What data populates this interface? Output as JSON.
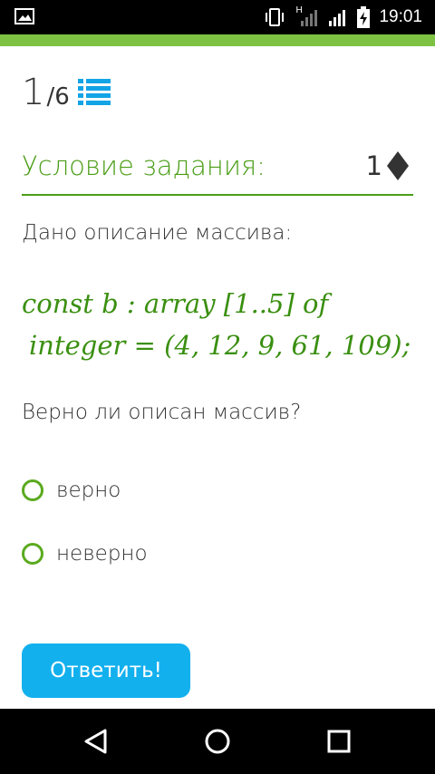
{
  "status_bar": {
    "time": "19:01",
    "network_label": "H",
    "icons": [
      "image-icon",
      "vibrate-icon",
      "signal-icon",
      "signal-icon",
      "battery-charging-icon"
    ]
  },
  "progress": {
    "current": "1",
    "total": "/6"
  },
  "condition": {
    "title": "Условие задания:",
    "points": "1"
  },
  "task": {
    "description": "Дано описание массива:",
    "formula_line1": "const b : array [1..5] of",
    "formula_line2": "integer = (4, 12, 9, 61, 109);",
    "question": "Верно ли описан массив?"
  },
  "options": [
    {
      "label": "верно"
    },
    {
      "label": "неверно"
    }
  ],
  "submit_label": "Ответить!",
  "colors": {
    "accent_green": "#4a9d16",
    "button_blue": "#13b0ee",
    "bar_green": "#7dc242"
  }
}
